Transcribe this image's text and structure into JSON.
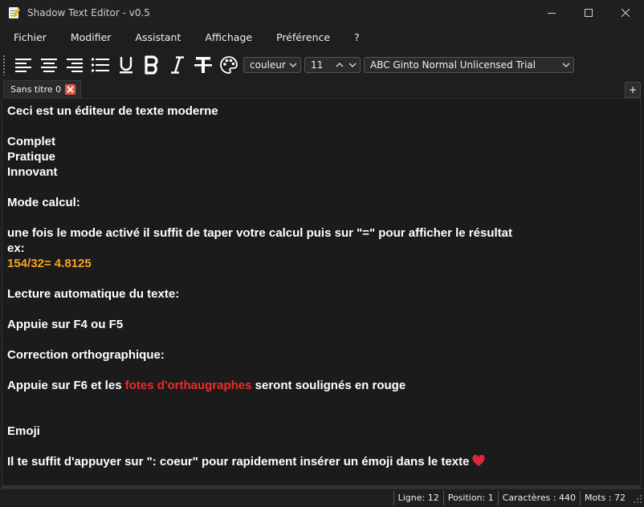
{
  "window": {
    "title": "Shadow Text Editor - v0.5"
  },
  "menu": [
    "Fichier",
    "Modifier",
    "Assistant",
    "Affichage",
    "Préférence",
    "?"
  ],
  "toolbar": {
    "color_select": "couleur",
    "font_size": "11",
    "font_family": "ABC Ginto Normal Unlicensed Trial"
  },
  "tab": {
    "label": "Sans titre 0",
    "add_label": "+"
  },
  "editor": {
    "lines": [
      [
        {
          "t": "Ceci est un éditeur de texte moderne"
        }
      ],
      [],
      [
        {
          "t": "Complet"
        }
      ],
      [
        {
          "t": "Pratique"
        }
      ],
      [
        {
          "t": "Innovant"
        }
      ],
      [],
      [
        {
          "t": "Mode calcul:"
        }
      ],
      [],
      [
        {
          "t": "une fois le mode activé il suffit de taper votre calcul puis sur \"=\" pour afficher le résultat"
        }
      ],
      [
        {
          "t": "ex:"
        }
      ],
      [
        {
          "t": "154/32= 4.8125",
          "c": "orange"
        }
      ],
      [],
      [
        {
          "t": "Lecture automatique du texte:"
        }
      ],
      [],
      [
        {
          "t": "Appuie sur F4 ou F5"
        }
      ],
      [],
      [
        {
          "t": "Correction orthographique:"
        }
      ],
      [],
      [
        {
          "t": "Appuie sur F6 et les "
        },
        {
          "t": "fotes d'orthaugraphes",
          "c": "red"
        },
        {
          "t": " seront soulignés en rouge"
        }
      ],
      [],
      [],
      [
        {
          "t": "Emoji"
        }
      ],
      [],
      [
        {
          "t": "Il te suffit d'appuyer sur \": coeur\" pour rapidement insérer un émoji dans le texte"
        },
        {
          "emoji": "heart"
        }
      ]
    ]
  },
  "status": {
    "line": "Ligne: 12",
    "position": "Position: 1",
    "chars": "Caractères : 440",
    "words": "Mots : 72"
  },
  "colors": {
    "orange_text": "#f3a320",
    "red_text": "#ef2b2b",
    "heart": "#e0283a"
  }
}
